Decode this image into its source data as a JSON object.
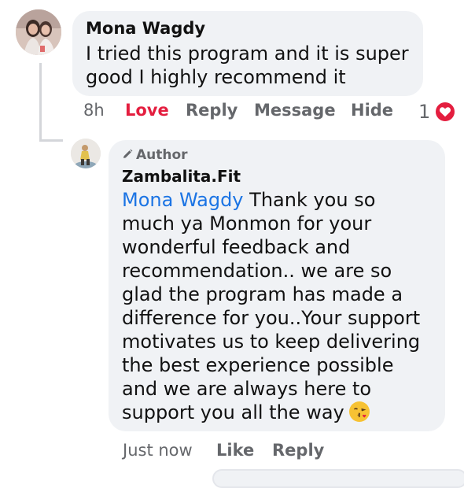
{
  "main_comment": {
    "author": "Mona Wagdy",
    "text_lines": [
      "I tried this program and it is super",
      "good I highly recommend it"
    ],
    "time": "8h",
    "actions": {
      "love": "Love",
      "reply": "Reply",
      "message": "Message",
      "hide": "Hide"
    },
    "reaction_count": "1",
    "reaction_icon": "heart-icon"
  },
  "reply_comment": {
    "tag": "Author",
    "tag_icon": "pencil-icon",
    "author": "Zambalita.Fit",
    "mention": "Mona Wagdy",
    "text_lines": [
      "Thank you so",
      "much ya Monmon for your",
      "wonderful feedback and",
      "recommendation.. we are so",
      "glad the program has made a",
      "difference for you..Your support",
      "motivates us to keep delivering",
      "the best experience possible",
      "and we are always here to",
      "support you all the way"
    ],
    "emoji": "kissing-face-emoji",
    "time": "Just now",
    "actions": {
      "like": "Like",
      "reply": "Reply"
    }
  },
  "colors": {
    "bubble_bg": "#f0f2f5",
    "love_red": "#e41e3f",
    "mention_blue": "#1b74e4",
    "meta_gray": "#65676b"
  }
}
